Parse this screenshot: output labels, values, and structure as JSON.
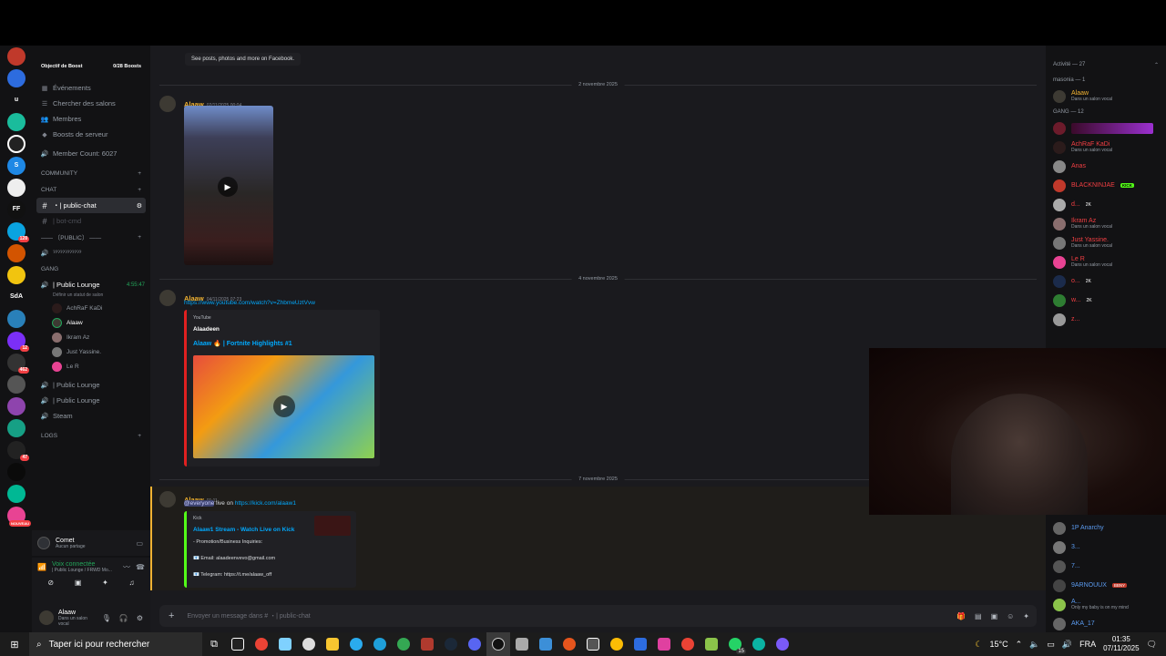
{
  "rail": {
    "icons": [
      "server-1",
      "server-2",
      "server-u",
      "server-4",
      "server-5",
      "server-s",
      "server-7",
      "server-ff",
      "server-9",
      "server-10",
      "server-11",
      "server-sda",
      "server-13",
      "server-14",
      "server-15",
      "server-16",
      "server-17",
      "server-18",
      "server-19",
      "server-20",
      "server-21",
      "server-22"
    ],
    "badges": {
      "u": "u",
      "sda": "SdA",
      "b128": "128",
      "b12": "12",
      "b462": "462",
      "b47": "47",
      "nouveau": "NOUVEAU"
    }
  },
  "sidebar": {
    "boost_label": "Objectif de Boost",
    "boost_count": "0/28 Boosts",
    "nav": [
      {
        "label": "Événements",
        "icon": "calendar-icon"
      },
      {
        "label": "Chercher des salons",
        "icon": "channel-search-icon"
      },
      {
        "label": "Membres",
        "icon": "members-icon"
      },
      {
        "label": "Boosts de serveur",
        "icon": "boost-icon"
      }
    ],
    "member_count": "Member Count: 6027",
    "cat_community": "COMMUNITY",
    "cat_chat": "CHAT",
    "public_chat": "・| public-chat",
    "bot_cmd": "| bot-cmd",
    "cat_public": "—— 〔PUBLIC〕 ——",
    "public_voice": "ˀˀˀˀˀˀˀˀˀˀˀˀ",
    "cat_gang": "GANG",
    "lounge1": "| Public Lounge",
    "lounge1_time": "4:55:47",
    "lounge_status": "Définir un statut de salon",
    "voice_users": [
      "AchRaF KaDi",
      "Alaaw",
      "Ikram Az",
      "Just Yassine.",
      "Le R"
    ],
    "lounge2": "| Public Lounge",
    "lounge3": "| Public Lounge",
    "steam": "Steam",
    "cat_logs": "LOGS",
    "activity_name": "Comet",
    "activity_status": "Aucun partage",
    "voice_title": "Voix connectée",
    "voice_channel": "| Public Lounge / FRWD Mo...",
    "user_name": "Alaaw",
    "user_status": "Dans un salon vocal"
  },
  "chat": {
    "top_embed": "See posts, photos and more on Facebook.",
    "date1": "2 novembre 2025",
    "date2": "4 novembre 2025",
    "date3": "7 novembre 2025",
    "msg1": {
      "author": "Alaaw",
      "ts": "02/11/2025 00:04"
    },
    "msg2": {
      "author": "Alaaw",
      "ts": "04/11/2025 07:23",
      "link": "https://www.youtube.com/watch?v=ZhbmeUztVvw",
      "provider": "YouTube",
      "channel": "Alaadeen",
      "title": "Alaaw 🔥 | Fortnite Highlights #1"
    },
    "msg3": {
      "author": "Alaaw",
      "ts": "01:11",
      "mention": "@everyone",
      "text": " live on ",
      "link": "https://kick.com/alaaw1",
      "provider": "Kick",
      "title": "Alaaw1 Stream - Watch Live on Kick",
      "line1": "- Promotion/Business Inquiries:",
      "line2": "📧 Email: alaadeenvevo@gmail.com",
      "line3": "📧 Telegram: https://t.me/alaaw_off"
    },
    "input_placeholder": "Envoyer un message dans #",
    "input_channel": "・| public-chat"
  },
  "members": {
    "activity_header": "Activité — 27",
    "group1": "masonia — 1",
    "group2": "GANG — 12",
    "m_alaaw": "Alaaw",
    "in_voice": "Dans un salon vocal",
    "list": [
      "AchRaF KaDi",
      "Anas",
      "BLACKNINJAE",
      "d...",
      "Ikram Az",
      "Just Yassine.",
      "Le R",
      "o...",
      "w...",
      "z..."
    ],
    "bottom": [
      "1P Anarchy",
      "3...",
      "7...",
      "9ARNOUUX",
      "A...",
      "AKA_17"
    ],
    "bottom_status": "Only my baby is on my mind",
    "tag_kick": "KICK",
    "tag_2k": "2K",
    "tag_bbny": "BBNY"
  },
  "taskbar": {
    "search": "Taper ici pour rechercher",
    "temp": "15°C",
    "lang": "FRA",
    "time": "01:35",
    "date": "07/11/2025",
    "badge15": "15"
  }
}
